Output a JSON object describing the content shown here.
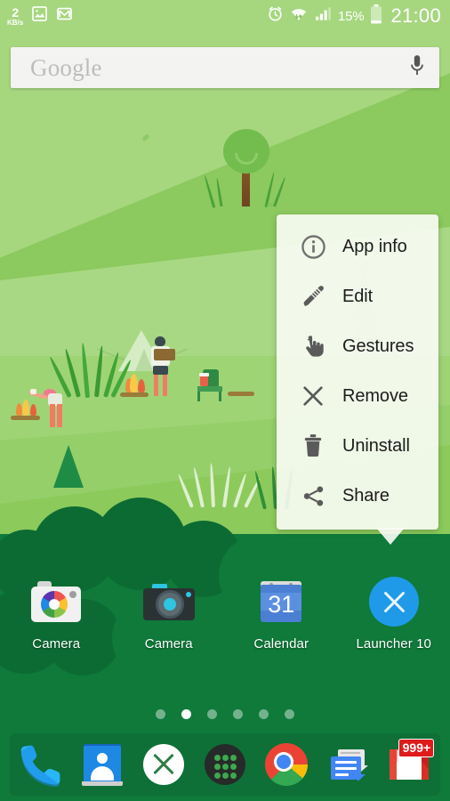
{
  "status_bar": {
    "network_speed_value": "2",
    "network_speed_unit": "KB/s",
    "icons": [
      "gallery-icon",
      "gmail-icon",
      "alarm-icon",
      "wifi-icon",
      "signal-icon"
    ],
    "battery_percent": "15%",
    "time": "21:00"
  },
  "search": {
    "label": "Google",
    "placeholder": "Google",
    "mic_icon": "microphone-icon"
  },
  "popup_menu": {
    "items": [
      {
        "label": "App info",
        "icon": "info-circle-icon"
      },
      {
        "label": "Edit",
        "icon": "pencil-icon"
      },
      {
        "label": "Gestures",
        "icon": "pointing-hand-icon"
      },
      {
        "label": "Remove",
        "icon": "close-x-icon"
      },
      {
        "label": "Uninstall",
        "icon": "trash-icon"
      },
      {
        "label": "Share",
        "icon": "share-nodes-icon"
      }
    ]
  },
  "app_grid": [
    {
      "label": "Camera",
      "icon": "google-camera-icon"
    },
    {
      "label": "Camera",
      "icon": "dark-camera-icon"
    },
    {
      "label": "Calendar",
      "icon": "calendar-icon",
      "day": "31"
    },
    {
      "label": "Launcher 10",
      "icon": "launcher10-icon"
    }
  ],
  "page_indicator": {
    "count": 6,
    "active_index": 1
  },
  "dock": [
    {
      "label": "Phone",
      "icon": "phone-icon"
    },
    {
      "label": "Contacts",
      "icon": "contacts-icon"
    },
    {
      "label": "Launcher 10",
      "icon": "launcher10-white-icon"
    },
    {
      "label": "App drawer",
      "icon": "app-drawer-icon"
    },
    {
      "label": "Chrome",
      "icon": "chrome-icon"
    },
    {
      "label": "Messages",
      "icon": "messages-icon"
    },
    {
      "label": "Gmail",
      "icon": "gmail-icon",
      "badge": "999+"
    }
  ],
  "colors": {
    "wallpaper_sky": "#a6d77f",
    "wallpaper_hill": "#8cc95e",
    "forest_dark": "#0f7a3a",
    "search_bg": "#f3f3f1",
    "popup_bg": "#fafcf5",
    "badge_red": "#e01b1b",
    "accent_blue": "#1e9ae8",
    "status_text": "#ffffff"
  },
  "wallpaper": {
    "name": "camping-illustration-wallpaper",
    "elements": [
      "tent",
      "campfire",
      "campers",
      "tree",
      "pine-tree",
      "grass-tufts",
      "camp-chair",
      "log",
      "forest-canopy"
    ]
  }
}
